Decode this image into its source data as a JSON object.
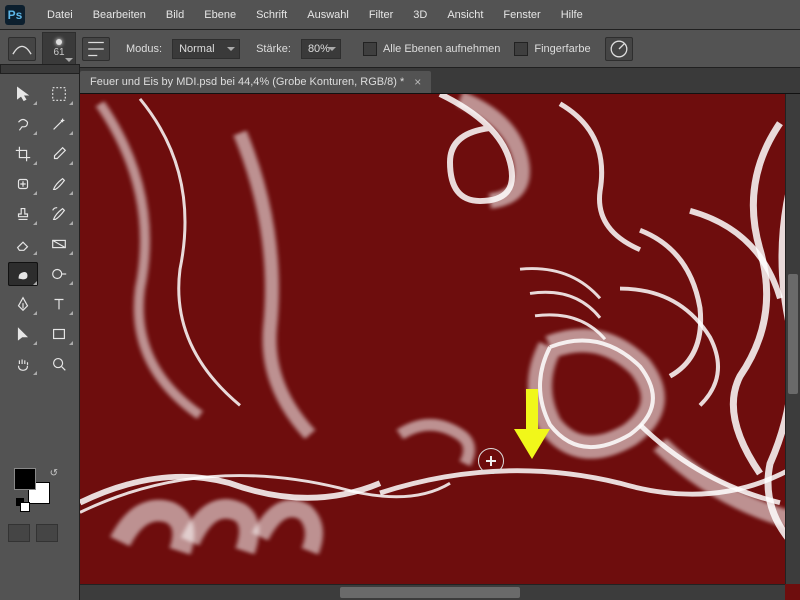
{
  "app": {
    "logo": "Ps"
  },
  "menu": [
    "Datei",
    "Bearbeiten",
    "Bild",
    "Ebene",
    "Schrift",
    "Auswahl",
    "Filter",
    "3D",
    "Ansicht",
    "Fenster",
    "Hilfe"
  ],
  "options": {
    "brush_size": "61",
    "mode_label": "Modus:",
    "mode_value": "Normal",
    "strength_label": "Stärke:",
    "strength_value": "80%",
    "sample_all_label": "Alle Ebenen aufnehmen",
    "fingerpaint_label": "Fingerfarbe"
  },
  "tab": {
    "title": "Feuer und Eis by MDI.psd bei 44,4% (Grobe Konturen, RGB/8) *"
  },
  "swatches": {
    "fg": "#000000",
    "bg": "#ffffff"
  },
  "canvas": {
    "bg": "#6e0d0d",
    "zoom": "44,4%"
  },
  "annotation": {
    "arrow_color": "#f1f71a"
  }
}
